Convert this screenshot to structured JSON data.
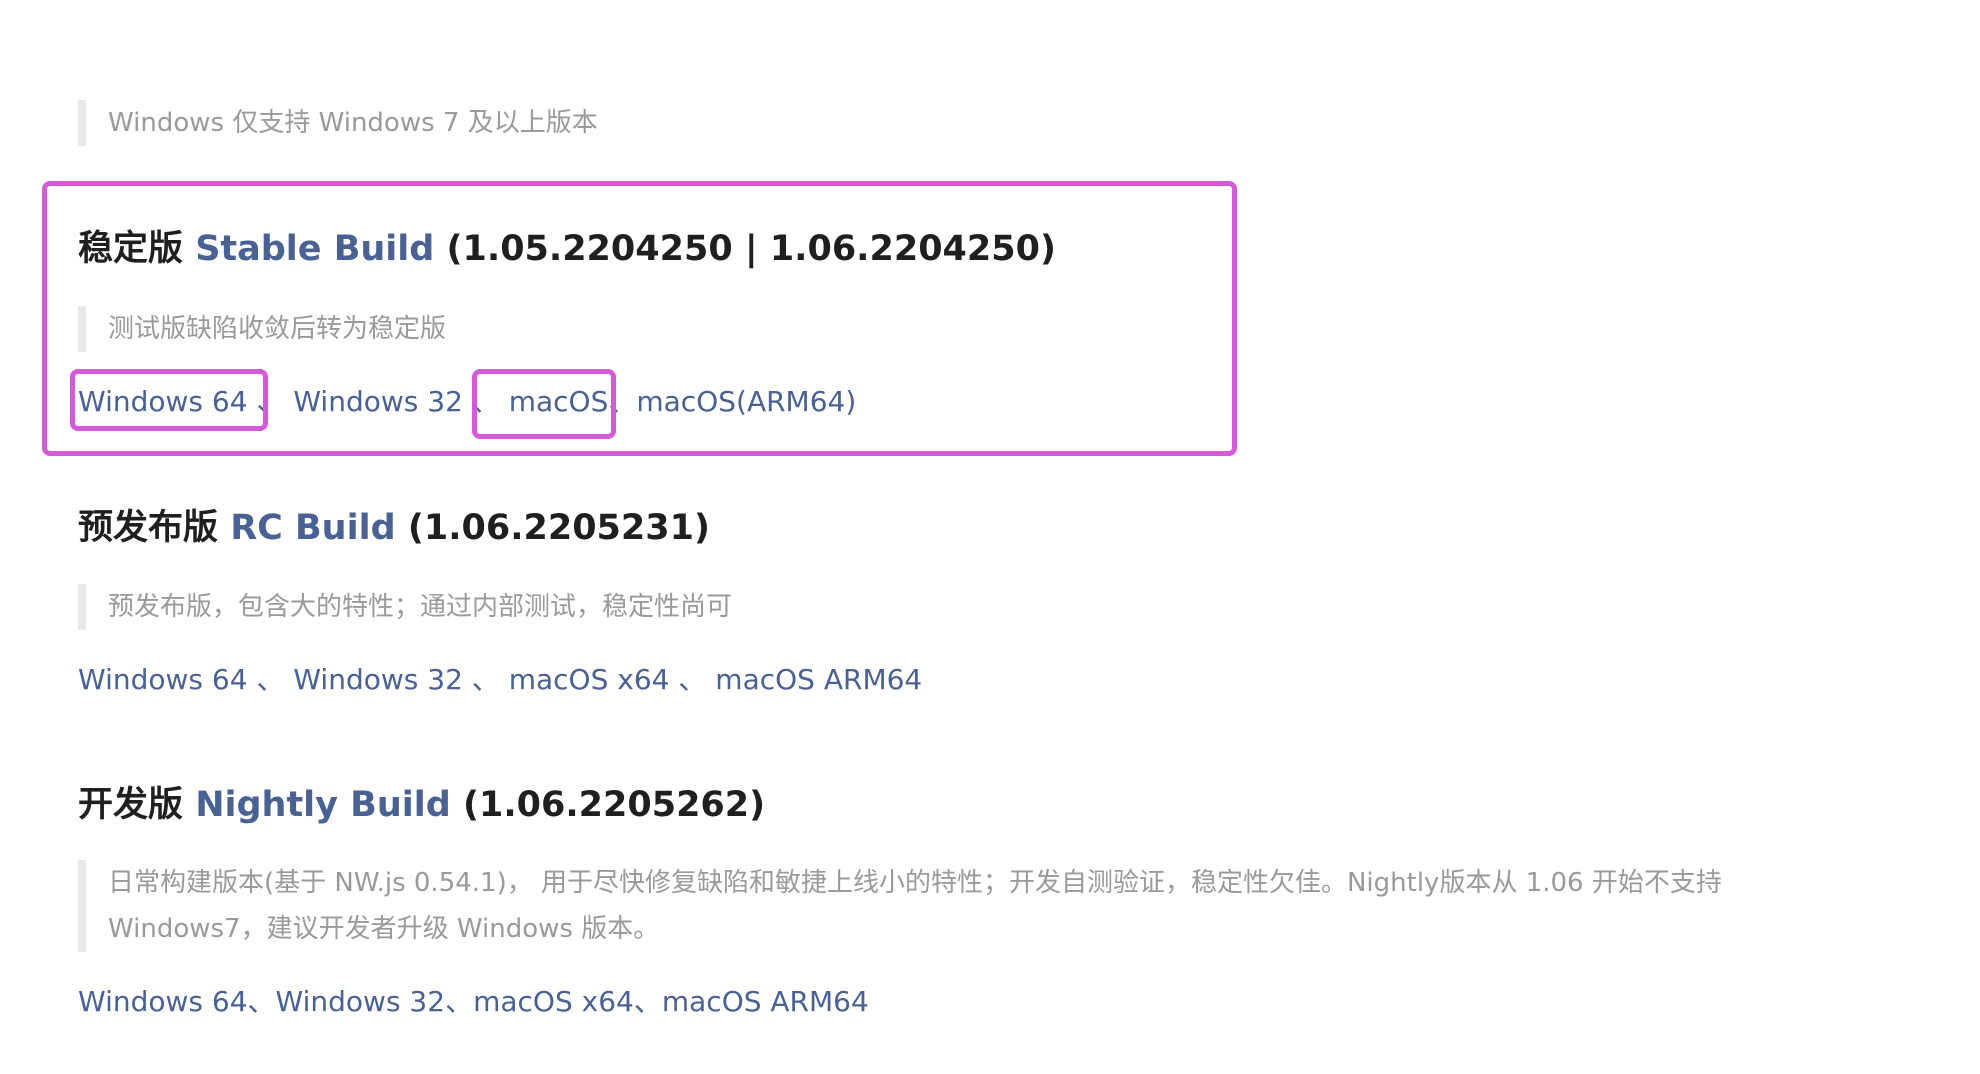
{
  "top_note": "Windows 仅支持 Windows 7 及以上版本",
  "stable": {
    "title_prefix": "稳定版 ",
    "title_accent": "Stable Build",
    "title_suffix": " (1.05.2204250 | 1.06.2204250)",
    "note": "测试版缺陷收敛后转为稳定版",
    "links": [
      "Windows 64",
      "Windows 32",
      "macOS",
      "macOS(ARM64)"
    ],
    "sep": "、"
  },
  "rc": {
    "title_prefix": "预发布版 ",
    "title_accent": "RC Build",
    "title_suffix": " (1.06.2205231)",
    "note": "预发布版，包含大的特性；通过内部测试，稳定性尚可",
    "links": [
      "Windows 64",
      "Windows 32",
      "macOS x64",
      "macOS ARM64"
    ],
    "sep": "、"
  },
  "nightly": {
    "title_prefix": "开发版 ",
    "title_accent": "Nightly Build",
    "title_suffix": " (1.06.2205262)",
    "note": "日常构建版本(基于 NW.js 0.54.1)， 用于尽快修复缺陷和敏捷上线小的特性；开发自测验证，稳定性欠佳。Nightly版本从 1.06 开始不支持 Windows7，建议开发者升级 Windows 版本。",
    "links": [
      "Windows 64",
      "Windows 32",
      "macOS x64",
      "macOS ARM64"
    ],
    "sep": "、"
  },
  "colors": {
    "link": "#4a6193",
    "highlight": "#d45ad8",
    "muted_text": "#9a9a9a",
    "quote_bar": "#e8e8e8"
  }
}
